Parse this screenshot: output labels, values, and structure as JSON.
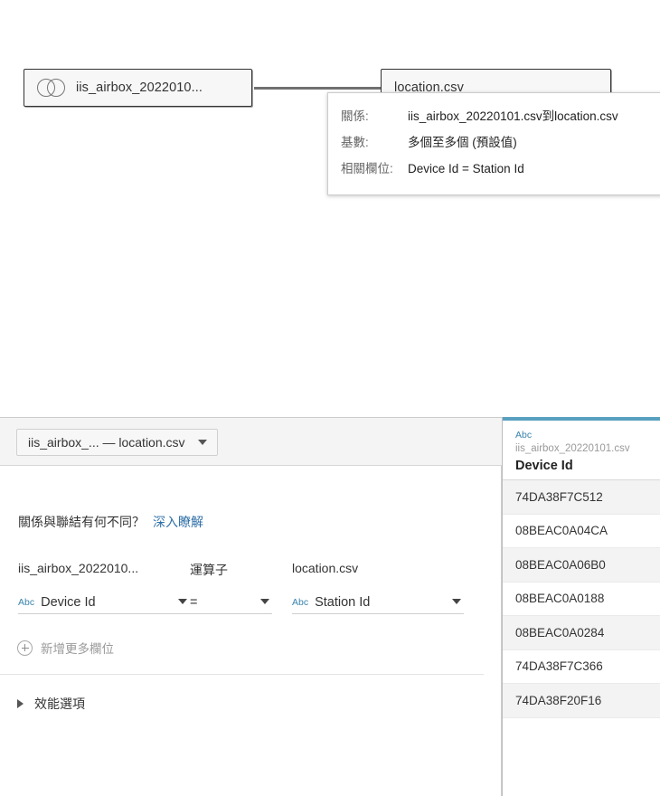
{
  "canvas": {
    "left_node": {
      "icon": "venn-diagram-icon",
      "label": "iis_airbox_2022010..."
    },
    "right_node": {
      "label": "location.csv"
    },
    "tooltip": {
      "rows": [
        {
          "key": "關係:",
          "value": "iis_airbox_20220101.csv到location.csv"
        },
        {
          "key": "基數:",
          "value": "多個至多個 (預設值)"
        },
        {
          "key": "相關欄位:",
          "value": "Device Id = Station Id"
        }
      ]
    }
  },
  "bottom_panel": {
    "tab": {
      "label": "iis_airbox_... — location.csv",
      "caret": "chevron-down-icon"
    },
    "collapse_icon": "‹",
    "help": {
      "question": "關係與聯結有何不同？",
      "link_label": "深入瞭解"
    },
    "condition": {
      "left_caption": "iis_airbox_2022010...",
      "left_field": {
        "type_label": "Abc",
        "value": "Device Id"
      },
      "operator_caption": "運算子",
      "operator_value": "=",
      "right_caption": "location.csv",
      "right_field": {
        "type_label": "Abc",
        "value": "Station Id"
      }
    },
    "add_fields_label": "新增更多欄位",
    "performance_options_label": "效能選項"
  },
  "data_grid": {
    "accent_color": "#59a0c0",
    "type_label": "Abc",
    "source": "iis_airbox_20220101.csv",
    "field_name": "Device Id",
    "rows": [
      "74DA38F7C512",
      "08BEAC0A04CA",
      "08BEAC0A06B0",
      "08BEAC0A0188",
      "08BEAC0A0284",
      "74DA38F7C366",
      "74DA38F20F16"
    ]
  }
}
